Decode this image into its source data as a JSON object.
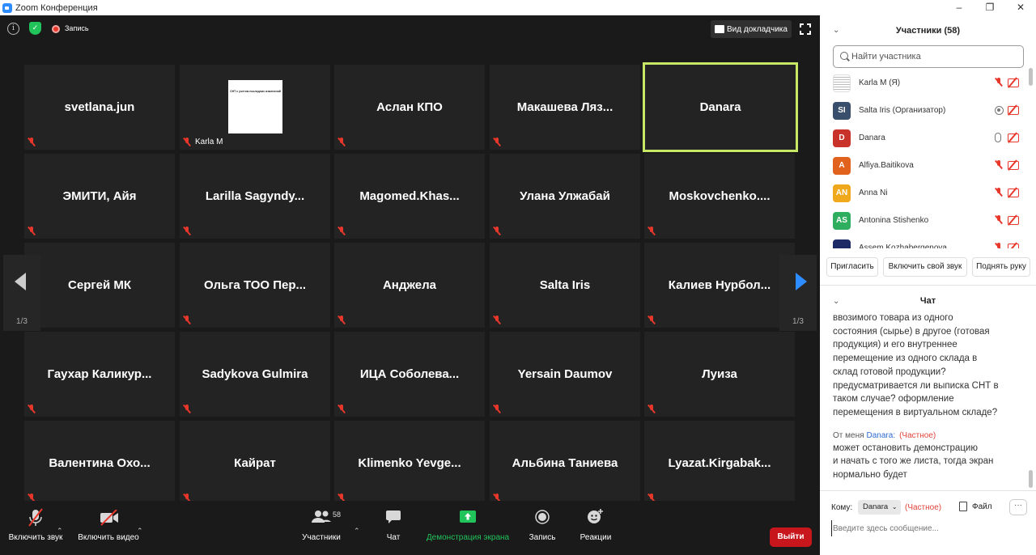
{
  "window": {
    "title": "Zoom Конференция",
    "controls": [
      "–",
      "❐",
      "✕"
    ]
  },
  "topbar": {
    "record_label": "Запись",
    "speaker_view_label": "Вид докладчика"
  },
  "grid": {
    "page_indicator": "1/3",
    "tiles": [
      {
        "name": "svetlana.jun",
        "active": false,
        "label": ""
      },
      {
        "name": "",
        "active": false,
        "label": "Karla M",
        "share_text": "СНТ с учетом последних изменений"
      },
      {
        "name": "Аслан КПО",
        "active": false,
        "label": ""
      },
      {
        "name": "Макашева Ляз...",
        "active": false,
        "label": ""
      },
      {
        "name": "Danara",
        "active": true,
        "label": ""
      },
      {
        "name": "ЭМИТИ, Айя",
        "active": false,
        "label": ""
      },
      {
        "name": "Larilla Sagyndy...",
        "active": false,
        "label": ""
      },
      {
        "name": "Magomed.Khas...",
        "active": false,
        "label": ""
      },
      {
        "name": "Улана Улжабай",
        "active": false,
        "label": ""
      },
      {
        "name": "Moskovchenko....",
        "active": false,
        "label": ""
      },
      {
        "name": "Сергей МК",
        "active": false,
        "label": ""
      },
      {
        "name": "Ольга ТОО Пер...",
        "active": false,
        "label": ""
      },
      {
        "name": "Анджела",
        "active": false,
        "label": ""
      },
      {
        "name": "Salta Iris",
        "active": false,
        "label": ""
      },
      {
        "name": "Калиев Нурбол...",
        "active": false,
        "label": ""
      },
      {
        "name": "Гаухар Каликур...",
        "active": false,
        "label": ""
      },
      {
        "name": "Sadykova Gulmira",
        "active": false,
        "label": ""
      },
      {
        "name": "ИЦА Соболева...",
        "active": false,
        "label": ""
      },
      {
        "name": "Yersain Daumov",
        "active": false,
        "label": ""
      },
      {
        "name": "Луиза",
        "active": false,
        "label": ""
      },
      {
        "name": "Валентина Охо...",
        "active": false,
        "label": ""
      },
      {
        "name": "Кайрат",
        "active": false,
        "label": ""
      },
      {
        "name": "Klimenko Yevge...",
        "active": false,
        "label": ""
      },
      {
        "name": "Альбина Таниева",
        "active": false,
        "label": ""
      },
      {
        "name": "Lyazat.Kirgabak...",
        "active": false,
        "label": ""
      }
    ]
  },
  "toolbar": {
    "unmute_label": "Включить звук",
    "video_label": "Включить видео",
    "participants_label": "Участники",
    "participants_count": "58",
    "chat_label": "Чат",
    "share_label": "Демонстрация экрана",
    "record_label": "Запись",
    "reactions_label": "Реакции",
    "end_label": "Выйти",
    "share_color": "#21c35b",
    "end_color": "#c8161d"
  },
  "participants_panel": {
    "title": "Участники (58)",
    "search_placeholder": "Найти участника",
    "people": [
      {
        "name": "Karla M (Я)",
        "initials": "",
        "color": "#ffffff",
        "mic": "muted",
        "icon": "screen-thumb-icon"
      },
      {
        "name": "Salta Iris (Организатор)",
        "initials": "SI",
        "color": "#3a4f6b",
        "mic": "host"
      },
      {
        "name": "Danara",
        "initials": "D",
        "color": "#c9322b",
        "mic": "on"
      },
      {
        "name": "Alfiya.Baitikova",
        "initials": "A",
        "color": "#e0621d",
        "mic": "muted"
      },
      {
        "name": "Anna Ni",
        "initials": "AN",
        "color": "#f0a81c",
        "mic": "muted"
      },
      {
        "name": "Antonina Stishenko",
        "initials": "AS",
        "color": "#2fae5f",
        "mic": "muted"
      },
      {
        "name": "Assem Kozhabergenova",
        "initials": "",
        "color": "#1d2a66",
        "mic": "muted"
      }
    ],
    "invite_label": "Пригласить",
    "unmute_me_label": "Включить свой звук",
    "raise_hand_label": "Поднять руку"
  },
  "chat": {
    "title": "Чат",
    "earlier_message_lines": [
      "ввозимого товара из одного",
      "состояния (сырье) в другое (готовая",
      "продукция) и его внутреннее",
      "перемещение из одного склада в",
      "склад готовой продукции?",
      "предусматривается ли выписка СНТ в",
      "таком случае? оформление",
      "перемещения в виртуальном складе?"
    ],
    "meta_from": "От меня",
    "meta_to": "Danara:",
    "meta_private": "(Частное)",
    "my_message_lines": [
      "может остановить демонстрацию",
      "и начать с того же листа, тогда экран",
      "нормально будет"
    ],
    "to_label": "Кому:",
    "to_value": "Danara",
    "to_private": "(Частное)",
    "file_label": "Файл",
    "more_label": "···",
    "input_placeholder": "Введите здесь сообщение..."
  }
}
